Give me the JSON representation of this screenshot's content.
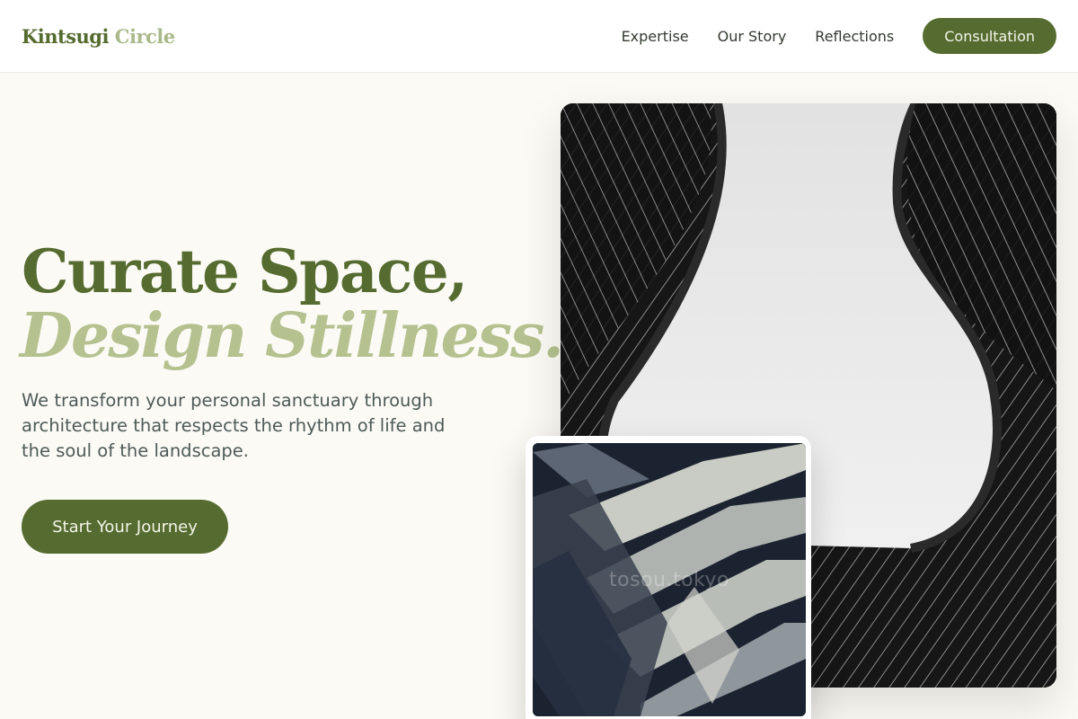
{
  "header": {
    "logo_part1": "Kintsugi",
    "logo_part2": "Circle",
    "nav": [
      "Expertise",
      "Our Story",
      "Reflections"
    ],
    "cta_label": "Consultation"
  },
  "hero": {
    "title_line1": "Curate Space,",
    "title_line2": "Design Stillness.",
    "description": "We transform your personal sanctuary through architecture that respects the rhythm of life and the soul of the landscape.",
    "cta_label": "Start Your Journey"
  },
  "images": {
    "main_alt_icon": "building-curves-photo",
    "secondary_alt_icon": "building-facade-photo",
    "secondary_watermark": "tosou.tokyo"
  },
  "colors": {
    "brand_green": "#556b2f",
    "brand_light_green": "#b5c18f",
    "background": "#fbfaf4"
  }
}
